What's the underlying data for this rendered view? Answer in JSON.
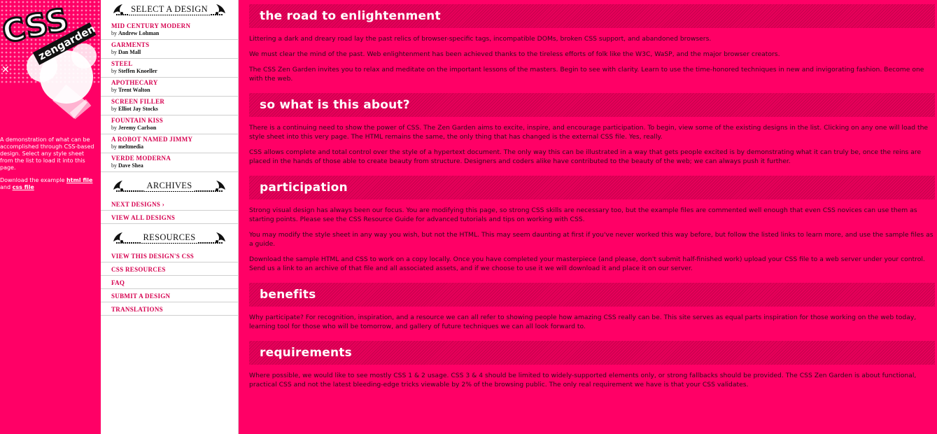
{
  "logo": {
    "word_css": "CSS",
    "word_zen": "zengarden"
  },
  "intro": {
    "text": "A demonstration of what can be accomplished through CSS-based design. Select any style sheet from the list to load it into this page.",
    "download_prefix": "Download the example ",
    "html_link": "html file",
    "and": " and ",
    "css_link": "css file"
  },
  "menu": {
    "select_title": "Select a Design",
    "designs": [
      {
        "name": "Mid Century Modern",
        "by": "by",
        "author": "Andrew Lohman"
      },
      {
        "name": "Garments",
        "by": "by",
        "author": "Dan Mall"
      },
      {
        "name": "Steel",
        "by": "by",
        "author": "Steffen Knoeller"
      },
      {
        "name": "Apothecary",
        "by": "by",
        "author": "Trent Walton"
      },
      {
        "name": "Screen Filler",
        "by": "by",
        "author": "Elliot Jay Stocks"
      },
      {
        "name": "Fountain Kiss",
        "by": "by",
        "author": "Jeremy Carlson"
      },
      {
        "name": "A Robot Named Jimmy",
        "by": "by",
        "author": "meltmedia"
      },
      {
        "name": "Verde Moderna",
        "by": "by",
        "author": "Dave Shea"
      }
    ],
    "archives_title": "Archives",
    "archives": [
      "Next Designs ›",
      "View All Designs"
    ],
    "resources_title": "Resources",
    "resources": [
      "View This Design's CSS",
      "CSS Resources",
      "FAQ",
      "Submit a Design",
      "Translations"
    ]
  },
  "main": {
    "sections": [
      {
        "title": "the road to enlightenment",
        "paragraphs": [
          "Littering a dark and dreary road lay the past relics of browser-specific tags, incompatible DOMs, broken CSS support, and abandoned browsers.",
          "We must clear the mind of the past. Web enlightenment has been achieved thanks to the tireless efforts of folk like the W3C, WaSP, and the major browser creators.",
          "The CSS Zen Garden invites you to relax and meditate on the important lessons of the masters. Begin to see with clarity. Learn to use the time-honored techniques in new and invigorating fashion. Become one with the web."
        ]
      },
      {
        "title": "so what is this about?",
        "paragraphs": [
          "There is a continuing need to show the power of CSS. The Zen Garden aims to excite, inspire, and encourage participation. To begin, view some of the existing designs in the list. Clicking on any one will load the style sheet into this very page. The HTML remains the same, the only thing that has changed is the external CSS file. Yes, really.",
          "CSS allows complete and total control over the style of a hypertext document. The only way this can be illustrated in a way that gets people excited is by demonstrating what it can truly be, once the reins are placed in the hands of those able to create beauty from structure. Designers and coders alike have contributed to the beauty of the web; we can always push it further."
        ]
      },
      {
        "title": "participation",
        "paragraphs": [
          "Strong visual design has always been our focus. You are modifying this page, so strong CSS skills are necessary too, but the example files are commented well enough that even CSS novices can use them as starting points. Please see the CSS Resource Guide for advanced tutorials and tips on working with CSS.",
          "You may modify the style sheet in any way you wish, but not the HTML. This may seem daunting at first if you've never worked this way before, but follow the listed links to learn more, and use the sample files as a guide.",
          "Download the sample HTML and CSS to work on a copy locally. Once you have completed your masterpiece (and please, don't submit half-finished work) upload your CSS file to a web server under your control. Send us a link to an archive of that file and all associated assets, and if we choose to use it we will download it and place it on our server."
        ]
      },
      {
        "title": "benefits",
        "paragraphs": [
          "Why participate? For recognition, inspiration, and a resource we can all refer to showing people how amazing CSS really can be. This site serves as equal parts inspiration for those working on the web today, learning tool for those who will be tomorrow, and gallery of future techniques we can all look forward to."
        ]
      },
      {
        "title": "requirements",
        "paragraphs": [
          "Where possible, we would like to see mostly CSS 1 & 2 usage. CSS 3 & 4 should be limited to widely-supported elements only, or strong fallbacks should be provided. The CSS Zen Garden is about functional, practical CSS and not the latest bleeding-edge tricks viewable by 2% of the browsing public. The only real requirement we have is that your CSS validates."
        ]
      }
    ]
  },
  "colors": {
    "page_bg": "#ff0066",
    "banner": "#e8005a",
    "menu_link": "#d6004f"
  }
}
